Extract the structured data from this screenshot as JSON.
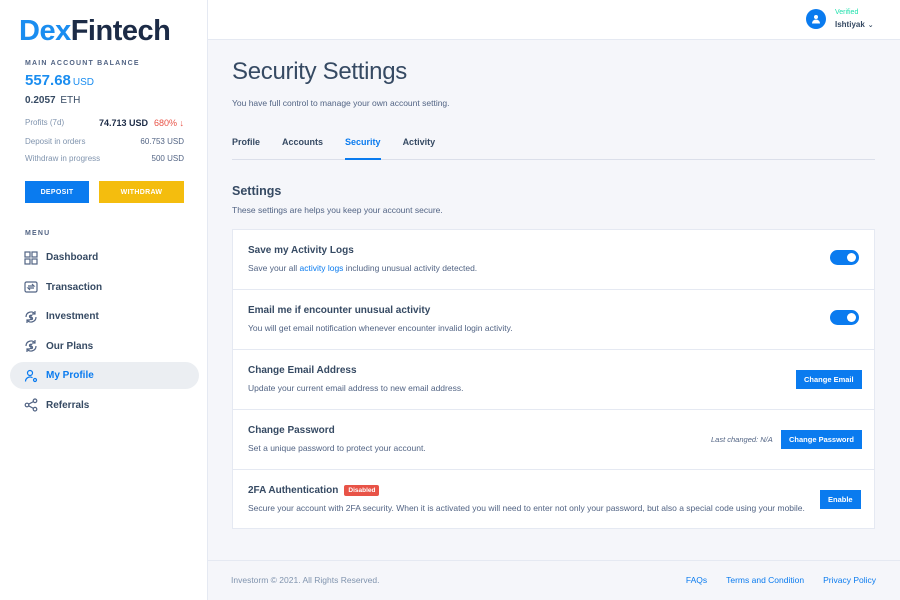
{
  "brand": {
    "part1": "Dex",
    "part2": "Fintech"
  },
  "balance": {
    "label": "MAIN ACCOUNT BALANCE",
    "amount": "557.68",
    "currency": "USD",
    "eth_amount": "0.2057",
    "eth_currency": "ETH"
  },
  "stats": {
    "profits_label": "Profits (7d)",
    "profits_value": "74.713 USD",
    "profits_pct": "680% ↓",
    "deposit_label": "Deposit in orders",
    "deposit_value": "60.753 USD",
    "withdraw_label": "Withdraw in progress",
    "withdraw_value": "500 USD"
  },
  "buttons": {
    "deposit": "DEPOSIT",
    "withdraw": "WITHDRAW"
  },
  "menu": {
    "label": "MENU",
    "items": [
      {
        "label": "Dashboard",
        "icon": "grid-icon"
      },
      {
        "label": "Transaction",
        "icon": "transfer-icon"
      },
      {
        "label": "Investment",
        "icon": "refresh-dollar-icon"
      },
      {
        "label": "Our Plans",
        "icon": "refresh-dollar-icon"
      },
      {
        "label": "My Profile",
        "icon": "user-settings-icon",
        "active": true
      },
      {
        "label": "Referrals",
        "icon": "share-icon"
      }
    ]
  },
  "user": {
    "status": "Verified",
    "name": "Ishtiyak"
  },
  "page": {
    "title": "Security Settings",
    "subtitle": "You have full control to manage your own account setting."
  },
  "tabs": [
    "Profile",
    "Accounts",
    "Security",
    "Activity"
  ],
  "active_tab": "Security",
  "settings": {
    "title": "Settings",
    "subtitle": "These settings are helps you keep your account secure.",
    "rows": [
      {
        "title": "Save my Activity Logs",
        "desc_pre": "Save your all ",
        "desc_link": "activity logs",
        "desc_post": " including unusual activity detected.",
        "toggle_on": true
      },
      {
        "title": "Email me if encounter unusual activity",
        "desc": "You will get email notification whenever encounter invalid login activity.",
        "toggle_on": true
      },
      {
        "title": "Change Email Address",
        "desc": "Update your current email address to new email address.",
        "button": "Change Email"
      },
      {
        "title": "Change Password",
        "desc": "Set a unique password to protect your account.",
        "button": "Change Password",
        "last_changed": "Last changed: N/A"
      },
      {
        "title": "2FA Authentication",
        "badge": "Disabled",
        "desc": "Secure your account with 2FA security. When it is activated you will need to enter not only your password, but also a special code using your mobile.",
        "button": "Enable"
      }
    ]
  },
  "footer": {
    "copyright": "Investorm © 2021. All Rights Reserved.",
    "links": [
      "FAQs",
      "Terms and Condition",
      "Privacy Policy"
    ]
  },
  "colors": {
    "accent": "#0a7bef",
    "warning": "#f4bd0e",
    "danger": "#e85347",
    "success": "#1ee0ac"
  }
}
